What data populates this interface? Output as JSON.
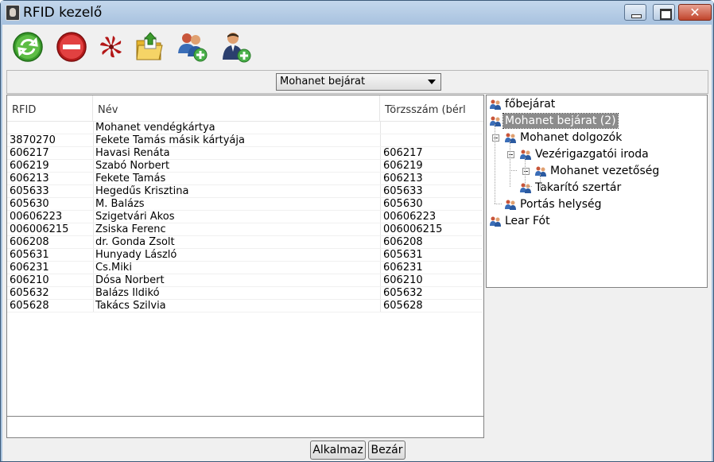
{
  "window": {
    "title": "RFID kezelő"
  },
  "toolbar": {
    "icons": [
      "refresh-icon",
      "stop-icon",
      "rfid-scan-icon",
      "folder-upload-icon",
      "add-group-icon",
      "add-user-icon"
    ]
  },
  "filter": {
    "selected": "Mohanet bejárat"
  },
  "table": {
    "columns": [
      "RFID",
      "Név",
      "Törzsszám (bérl"
    ],
    "rows": [
      {
        "rfid": "",
        "nev": "Mohanet vendégkártya",
        "tsz": ""
      },
      {
        "rfid": "3870270",
        "nev": "Fekete Tamás másik kártyája",
        "tsz": ""
      },
      {
        "rfid": "606217",
        "nev": "Havasi Renáta",
        "tsz": "606217"
      },
      {
        "rfid": "606219",
        "nev": "Szabó Norbert",
        "tsz": "606219"
      },
      {
        "rfid": "606213",
        "nev": "Fekete Tamás",
        "tsz": "606213"
      },
      {
        "rfid": "605633",
        "nev": "Hegedűs Krisztina",
        "tsz": "605633"
      },
      {
        "rfid": "605630",
        "nev": "M. Balázs",
        "tsz": "605630"
      },
      {
        "rfid": "00606223",
        "nev": "Szigetvári Ákos",
        "tsz": "00606223"
      },
      {
        "rfid": "006006215",
        "nev": "Zsiska Ferenc",
        "tsz": "006006215"
      },
      {
        "rfid": "606208",
        "nev": "dr. Gonda Zsolt",
        "tsz": "606208"
      },
      {
        "rfid": "605631",
        "nev": "Hunyady László",
        "tsz": "605631"
      },
      {
        "rfid": "606231",
        "nev": "Cs.Miki",
        "tsz": "606231"
      },
      {
        "rfid": "606210",
        "nev": "Dósa Norbert",
        "tsz": "606210"
      },
      {
        "rfid": "605632",
        "nev": "Balázs Ildikó",
        "tsz": "605632"
      },
      {
        "rfid": "605628",
        "nev": "Takács Szilvia",
        "tsz": "605628"
      }
    ]
  },
  "tree": {
    "items": [
      {
        "label": "főbejárat",
        "level": 0,
        "expander": false,
        "selected": false
      },
      {
        "label": "Mohanet bejárat (2)",
        "level": 0,
        "expander": true,
        "selected": true
      },
      {
        "label": "Mohanet dolgozók",
        "level": 1,
        "expander": true,
        "selected": false
      },
      {
        "label": "Vezérigazgatói iroda",
        "level": 2,
        "expander": true,
        "selected": false
      },
      {
        "label": "Mohanet vezetőség",
        "level": 3,
        "expander": false,
        "selected": false
      },
      {
        "label": "Takarító szertár",
        "level": 2,
        "expander": false,
        "selected": false
      },
      {
        "label": "Portás helység",
        "level": 1,
        "expander": false,
        "selected": false
      },
      {
        "label": "Lear Fót",
        "level": 0,
        "expander": false,
        "selected": false
      }
    ]
  },
  "buttons": {
    "apply": "Alkalmaz",
    "close": "Bezár"
  },
  "colors": {
    "titlebar": "#a8c2df",
    "selection": "#8c8c8c",
    "close_button": "#c0442c"
  }
}
